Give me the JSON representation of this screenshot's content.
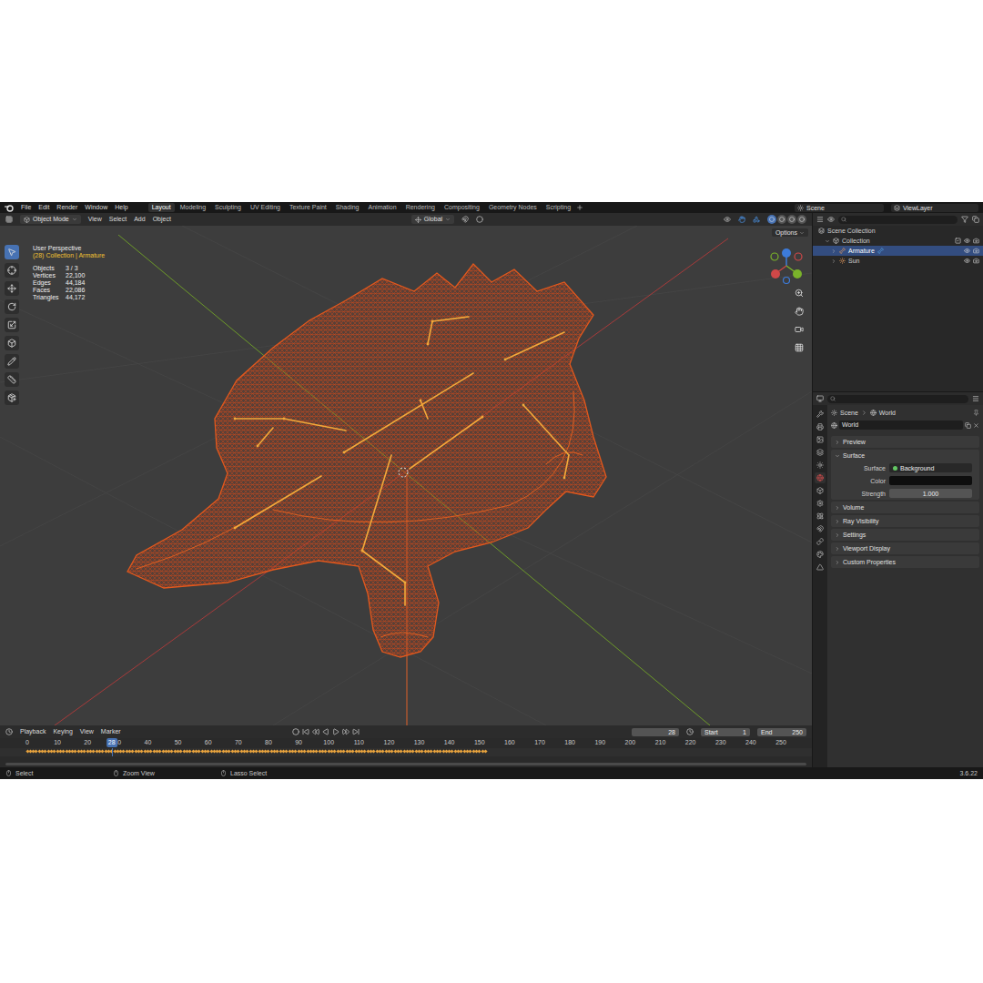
{
  "topbar": {
    "menus": [
      "File",
      "Edit",
      "Render",
      "Window",
      "Help"
    ],
    "workspaces": [
      {
        "label": "Layout",
        "selected": true
      },
      {
        "label": "Modeling",
        "selected": false
      },
      {
        "label": "Sculpting",
        "selected": false
      },
      {
        "label": "UV Editing",
        "selected": false
      },
      {
        "label": "Texture Paint",
        "selected": false
      },
      {
        "label": "Shading",
        "selected": false
      },
      {
        "label": "Animation",
        "selected": false
      },
      {
        "label": "Rendering",
        "selected": false
      },
      {
        "label": "Compositing",
        "selected": false
      },
      {
        "label": "Geometry Nodes",
        "selected": false
      },
      {
        "label": "Scripting",
        "selected": false
      }
    ],
    "scene": "Scene",
    "view_layer": "ViewLayer"
  },
  "viewport_header": {
    "mode": "Object Mode",
    "menus": [
      "View",
      "Select",
      "Add",
      "Object"
    ],
    "orientation": "Global",
    "options": "Options",
    "shading": [
      {
        "selected": true
      },
      {
        "selected": false
      },
      {
        "selected": false
      },
      {
        "selected": false
      }
    ]
  },
  "toolbar": [
    {
      "selected": true
    },
    {
      "selected": false
    },
    {
      "selected": false
    },
    {
      "selected": false
    },
    {
      "selected": false
    },
    {
      "selected": false
    },
    {
      "selected": false
    },
    {
      "selected": false
    },
    {
      "selected": false
    }
  ],
  "viewport_overlay": {
    "view": "User Perspective",
    "context": "(28) Collection | Armature",
    "stats": [
      {
        "label": "Objects",
        "value": "3 / 3"
      },
      {
        "label": "Vertices",
        "value": "22,100"
      },
      {
        "label": "Edges",
        "value": "44,184"
      },
      {
        "label": "Faces",
        "value": "22,086"
      },
      {
        "label": "Triangles",
        "value": "44,172"
      }
    ]
  },
  "timeline": {
    "menus": [
      "Playback",
      "Keying",
      "View",
      "Marker"
    ],
    "current_frame": "28",
    "start_label": "Start",
    "start": "1",
    "end_label": "End",
    "end": "250",
    "ticks": [
      "0",
      "10",
      "20",
      "30",
      "40",
      "50",
      "60",
      "70",
      "80",
      "90",
      "100",
      "110",
      "120",
      "130",
      "140",
      "150",
      "160",
      "170",
      "180",
      "190",
      "200",
      "210",
      "220",
      "230",
      "240",
      "250"
    ],
    "keyframes": {
      "first": 0,
      "last": 152
    }
  },
  "outliner": {
    "items": [
      {
        "label": "Scene Collection",
        "depth": 0,
        "selected": false
      },
      {
        "label": "Collection",
        "depth": 1,
        "selected": false
      },
      {
        "label": "Armature",
        "depth": 2,
        "selected": true
      },
      {
        "label": "Sun",
        "depth": 2,
        "selected": false
      }
    ]
  },
  "properties": {
    "tabs": [
      {
        "selected": false
      },
      {
        "selected": false
      },
      {
        "selected": false
      },
      {
        "selected": false
      },
      {
        "selected": false
      },
      {
        "selected": true
      },
      {
        "selected": false
      },
      {
        "selected": false
      },
      {
        "selected": false
      },
      {
        "selected": false
      },
      {
        "selected": false
      },
      {
        "selected": false
      },
      {
        "selected": false
      }
    ],
    "breadcrumb": [
      "Scene",
      "World"
    ],
    "datablock": "World",
    "panels": [
      {
        "label": "Preview",
        "expanded": false,
        "fields": []
      },
      {
        "label": "Surface",
        "expanded": true,
        "fields": [
          {
            "label": "Surface",
            "value": "Background",
            "kind": "shader"
          },
          {
            "label": "Color",
            "value": "",
            "kind": "color"
          },
          {
            "label": "Strength",
            "value": "1.000",
            "kind": "number"
          }
        ]
      },
      {
        "label": "Volume",
        "expanded": false,
        "fields": []
      },
      {
        "label": "Ray Visibility",
        "expanded": false,
        "fields": []
      },
      {
        "label": "Settings",
        "expanded": false,
        "fields": []
      },
      {
        "label": "Viewport Display",
        "expanded": false,
        "fields": []
      },
      {
        "label": "Custom Properties",
        "expanded": false,
        "fields": []
      }
    ]
  },
  "status_bar": {
    "items": [
      "Select",
      "Zoom View",
      "Lasso Select"
    ],
    "version": "3.6.22"
  }
}
